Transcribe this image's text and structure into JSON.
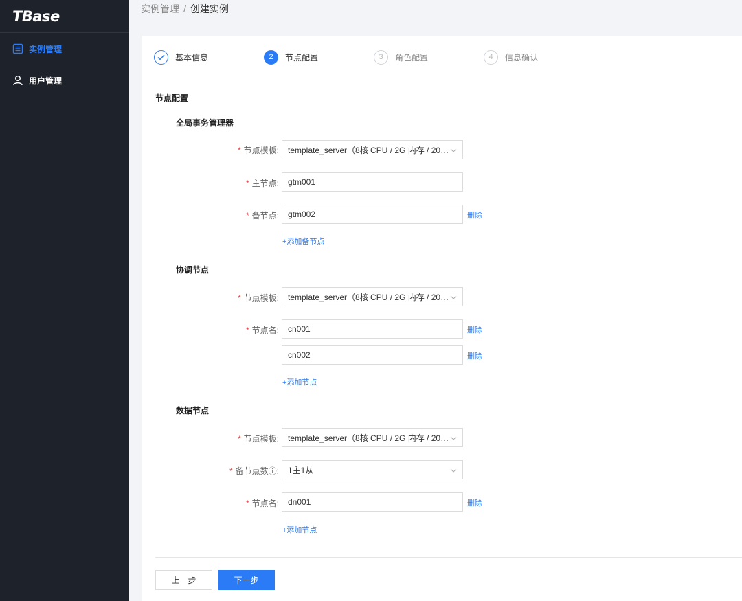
{
  "app": {
    "logo": "TBase"
  },
  "sidebar": {
    "items": [
      {
        "label": "实例管理",
        "icon": "list-icon",
        "active": true
      },
      {
        "label": "用户管理",
        "icon": "user-icon",
        "active": false
      }
    ]
  },
  "breadcrumb": {
    "parent": "实例管理",
    "separator": "/",
    "current": "创建实例"
  },
  "steps": [
    {
      "index": "1",
      "label": "基本信息",
      "status": "done"
    },
    {
      "index": "2",
      "label": "节点配置",
      "status": "active"
    },
    {
      "index": "3",
      "label": "角色配置",
      "status": "pending"
    },
    {
      "index": "4",
      "label": "信息确认",
      "status": "pending"
    }
  ],
  "section_title": "节点配置",
  "gtm": {
    "title": "全局事务管理器",
    "template_label": "节点模板",
    "template_value": "template_server（8核 CPU / 2G 内存 / 200...",
    "master_label": "主节点",
    "master_value": "gtm001",
    "standby_label": "备节点",
    "standby_value": "gtm002",
    "delete_label": "删除",
    "add_label": "+添加备节点"
  },
  "cn": {
    "title": "协调节点",
    "template_label": "节点模板",
    "template_value": "template_server（8核 CPU / 2G 内存 / 200...",
    "name_label": "节点名",
    "names": [
      "cn001",
      "cn002"
    ],
    "delete_label": "删除",
    "add_label": "+添加节点"
  },
  "dn": {
    "title": "数据节点",
    "template_label": "节点模板",
    "template_value": "template_server（8核 CPU / 2G 内存 / 200...",
    "standby_count_label": "备节点数ⓘ",
    "standby_count_value": "1主1从",
    "name_label": "节点名",
    "name_value": "dn001",
    "delete_label": "删除",
    "add_label": "+添加节点"
  },
  "buttons": {
    "prev": "上一步",
    "next": "下一步"
  },
  "colors": {
    "accent": "#2a7bf5",
    "sidebar_bg": "#1e222b",
    "required": "#e54545"
  }
}
